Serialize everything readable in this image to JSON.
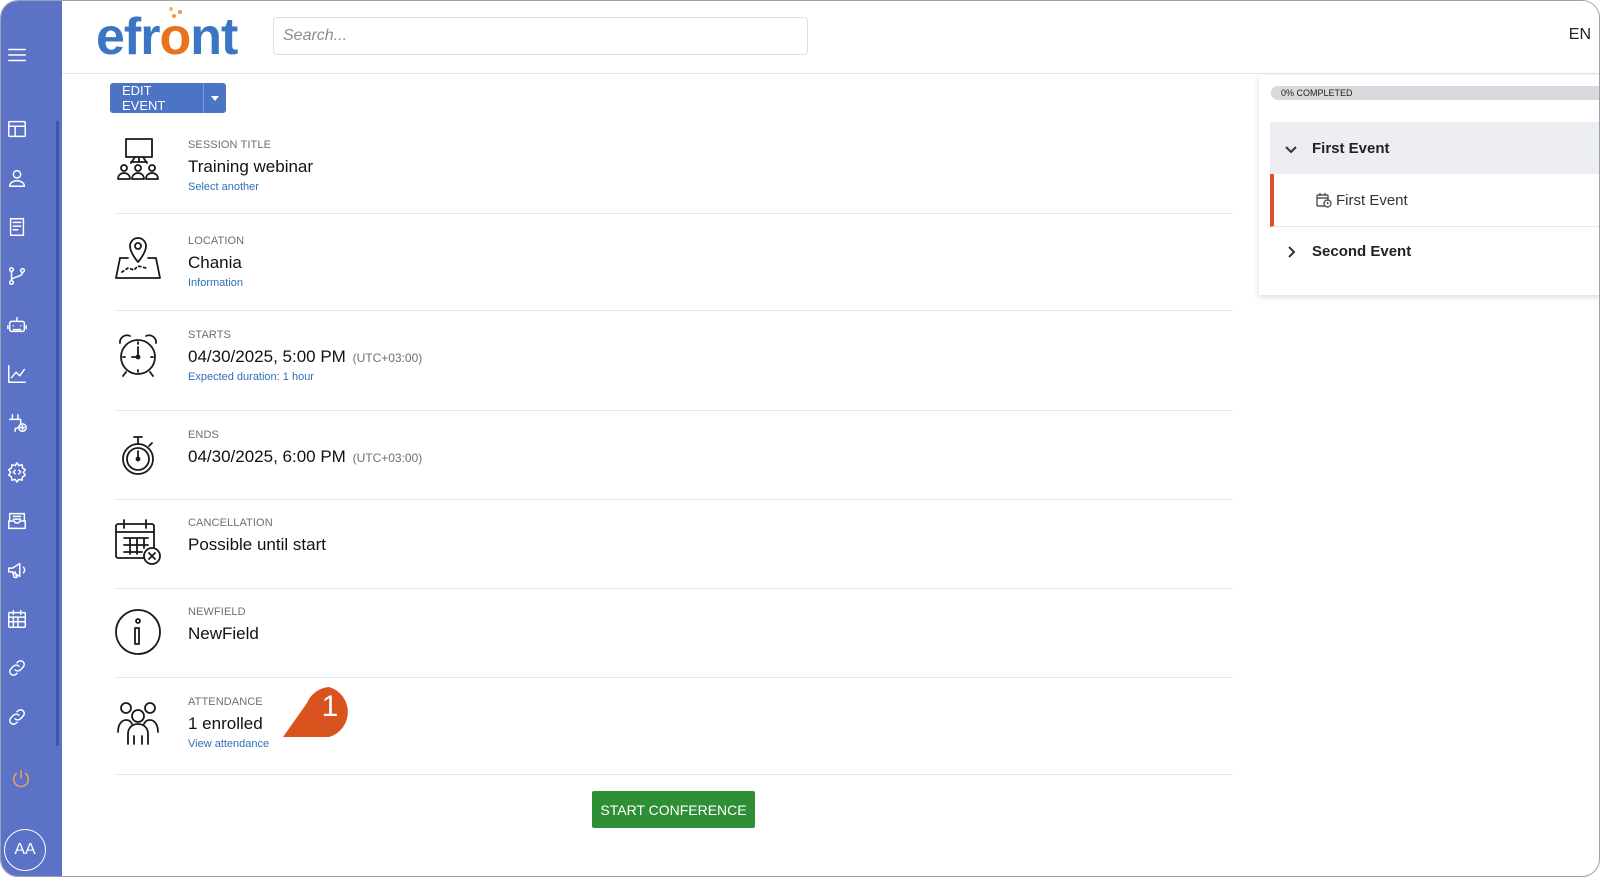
{
  "header": {
    "logo_text_pre": "efr",
    "logo_text_o": "o",
    "logo_text_post": "nt",
    "search_placeholder": "Search...",
    "language": "EN"
  },
  "sidebar": {
    "items": [
      {
        "name": "menu-icon"
      },
      {
        "name": "dashboard-icon"
      },
      {
        "name": "users-icon"
      },
      {
        "name": "courses-icon"
      },
      {
        "name": "learning-paths-icon"
      },
      {
        "name": "robot-icon"
      },
      {
        "name": "reports-icon"
      },
      {
        "name": "plugins-icon"
      },
      {
        "name": "settings-icon"
      },
      {
        "name": "messages-icon"
      },
      {
        "name": "announcements-icon"
      },
      {
        "name": "calendar-icon"
      },
      {
        "name": "links-icon"
      },
      {
        "name": "links-icon-2"
      },
      {
        "name": "power-icon"
      }
    ],
    "avatar_initials": "AA"
  },
  "toolbar": {
    "edit_label": "EDIT EVENT"
  },
  "details": {
    "session": {
      "label": "SESSION TITLE",
      "value": "Training webinar",
      "link": "Select another"
    },
    "location": {
      "label": "LOCATION",
      "value": "Chania",
      "link": "Information"
    },
    "starts": {
      "label": "STARTS",
      "value": "04/30/2025, 5:00 PM",
      "tz": "(UTC+03:00)",
      "link": "Expected duration: 1 hour"
    },
    "ends": {
      "label": "ENDS",
      "value": "04/30/2025, 6:00 PM",
      "tz": "(UTC+03:00)"
    },
    "cancellation": {
      "label": "CANCELLATION",
      "value": "Possible until start"
    },
    "newfield": {
      "label": "NEWFIELD",
      "value": "NewField"
    },
    "attendance": {
      "label": "ATTENDANCE",
      "value": "1 enrolled",
      "link": "View attendance"
    }
  },
  "start_button": "START CONFERENCE",
  "callout_number": "1",
  "panel": {
    "progress_text": "0% COMPLETED",
    "progress_fraction": 0,
    "groups": [
      {
        "label": "First Event",
        "expanded": true,
        "children": [
          {
            "label": "First Event",
            "active": true
          }
        ]
      },
      {
        "label": "Second Event",
        "expanded": false
      }
    ]
  },
  "colors": {
    "sidebar": "#5b72c6",
    "primary_button": "#4b74c4",
    "start_button": "#2f8f37",
    "callout": "#d9531e",
    "active_marker": "#e24c31",
    "logo_blue": "#3a76c4",
    "logo_orange": "#e8731d"
  }
}
